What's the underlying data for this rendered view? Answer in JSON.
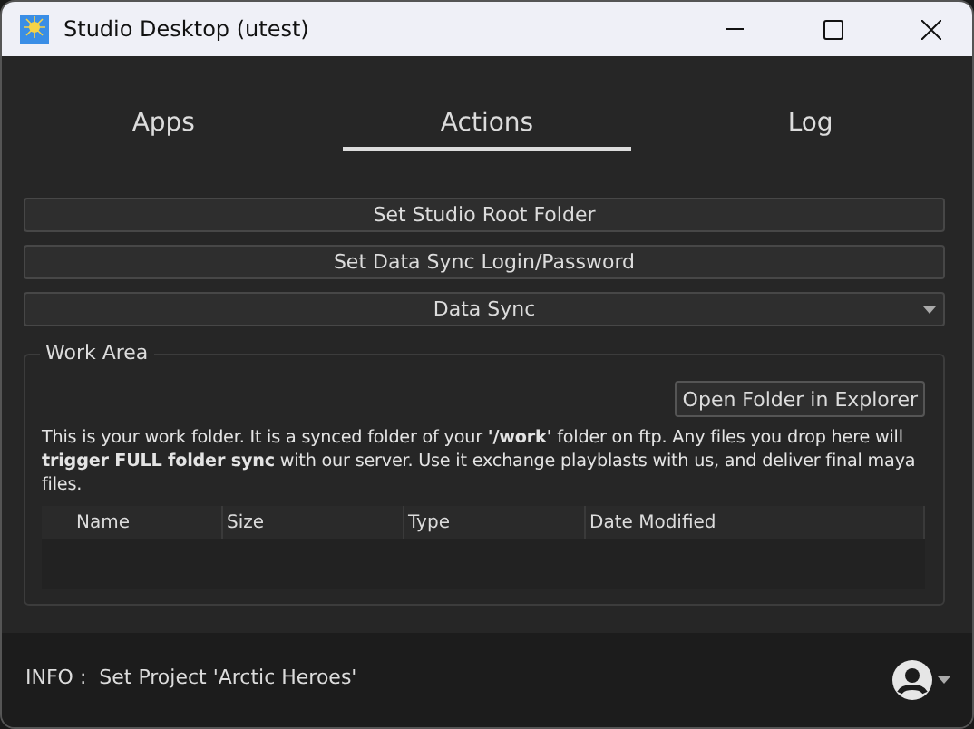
{
  "window": {
    "title": "Studio Desktop (utest)"
  },
  "tabs": [
    {
      "label": "Apps",
      "selected": false
    },
    {
      "label": "Actions",
      "selected": true
    },
    {
      "label": "Log",
      "selected": false
    }
  ],
  "buttons": [
    "Set Studio Root Folder",
    "Set Data Sync Login/Password"
  ],
  "dropdown": {
    "value": "Data Sync"
  },
  "work_area": {
    "title": "Work Area",
    "open_button": "Open Folder in Explorer",
    "description": "This is your work folder. It is a synced folder of your **'/work'** folder on ftp. Any files you drop here will **trigger FULL folder sync** with our server. Use it exchange playblasts with us, and deliver final maya files.",
    "table": {
      "columns": [
        "Name",
        "Size",
        "Type",
        "Date Modified"
      ]
    }
  },
  "status_bar": {
    "message": "INFO :  Set Project 'Arctic Heroes'"
  }
}
